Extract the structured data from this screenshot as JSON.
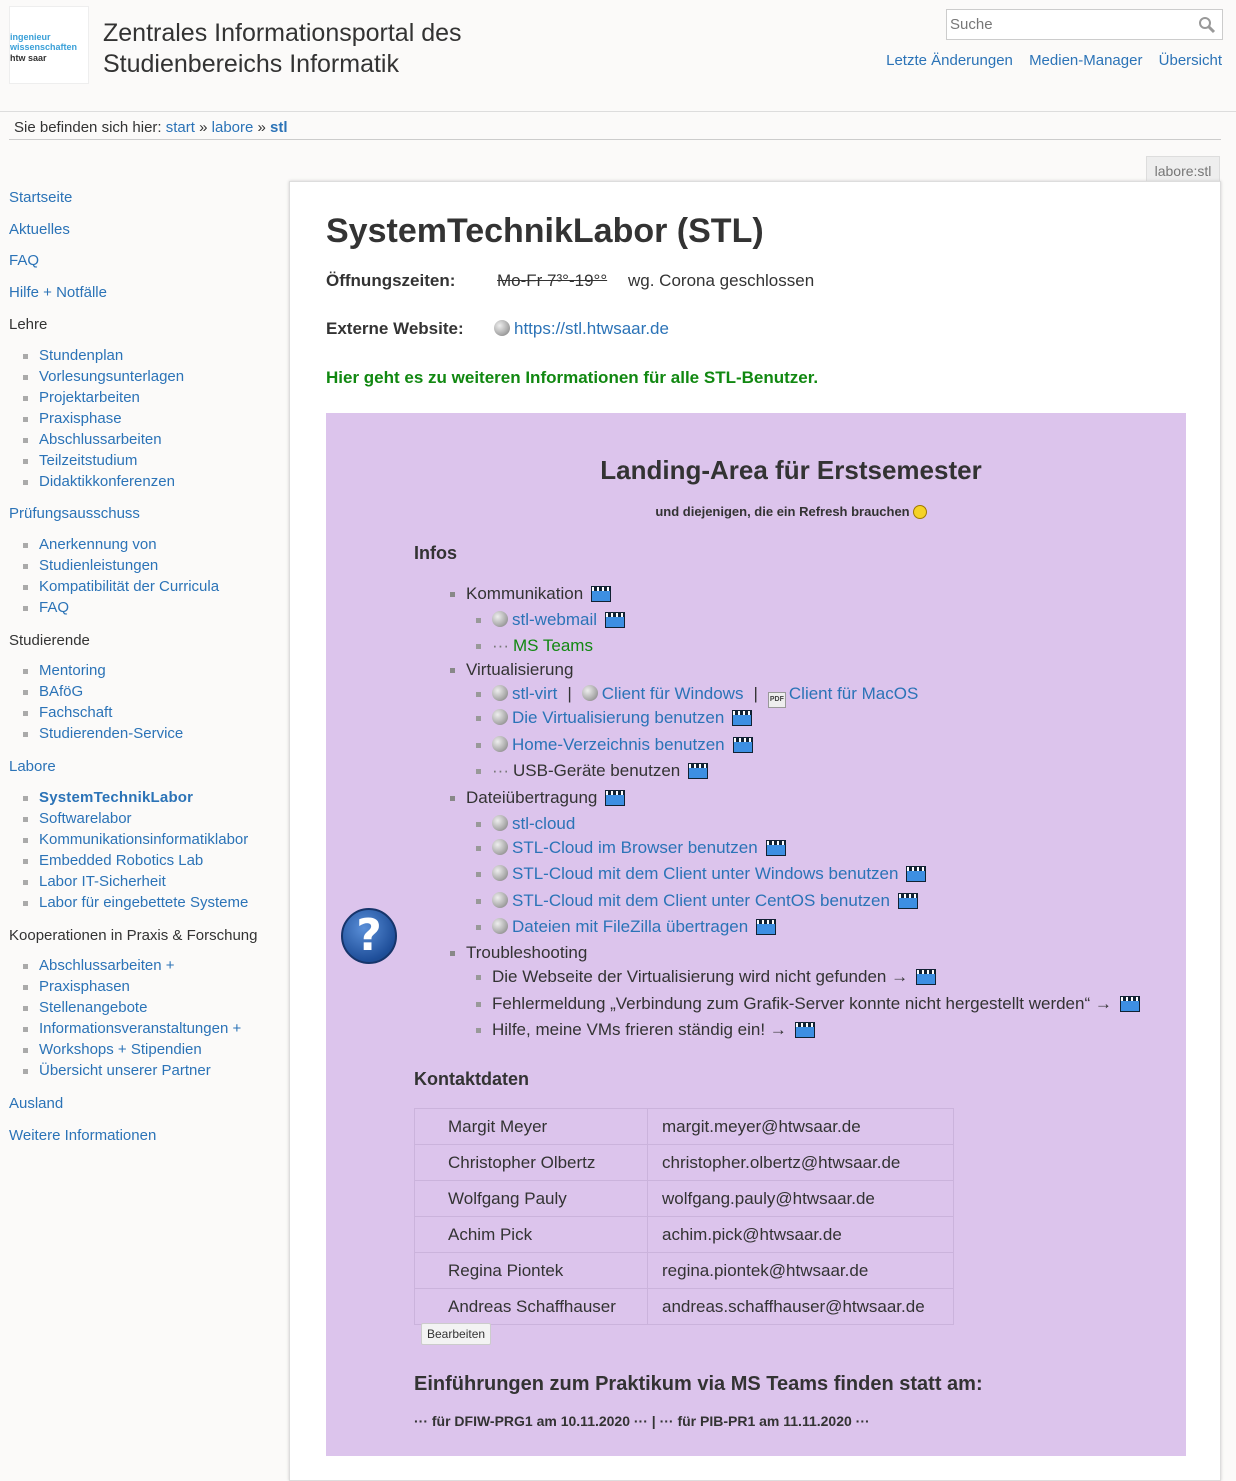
{
  "header": {
    "logo": {
      "line1": "ingenieur",
      "line2": "wissenschaften",
      "line3": "htw saar"
    },
    "title_line1": "Zentrales Informationsportal des",
    "title_line2": "Studienbereichs Informatik",
    "search_placeholder": "Suche",
    "usertools": [
      "Letzte Änderungen",
      "Medien-Manager",
      "Übersicht"
    ]
  },
  "breadcrumbs": {
    "prefix": "Sie befinden sich hier:",
    "items": [
      "start",
      "labore",
      "stl"
    ],
    "sep": "»"
  },
  "sidebar": {
    "startseite": "Startseite",
    "aktuelles": "Aktuelles",
    "faq": "FAQ",
    "hilfe": "Hilfe + Notfälle",
    "lehre": "Lehre",
    "lehre_items": [
      "Stundenplan",
      "Vorlesungsunterlagen",
      "Projektarbeiten",
      "Praxisphase",
      "Abschlussarbeiten",
      "Teilzeitstudium",
      "Didaktikkonferenzen"
    ],
    "pruefung": "Prüfungsausschuss",
    "pruefung_items": [
      "Anerkennung von",
      "Studienleistungen",
      "Kompatibilität der Curricula",
      "FAQ"
    ],
    "studierende": "Studierende",
    "studierende_items": [
      "Mentoring",
      "BAföG",
      "Fachschaft",
      "Studierenden-Service"
    ],
    "labore": "Labore",
    "labore_items": [
      "SystemTechnikLabor",
      "Softwarelabor",
      "Kommunikationsinformatiklabor",
      "Embedded Robotics Lab",
      "Labor IT-Sicherheit",
      "Labor für eingebettete Systeme"
    ],
    "kooperationen": "Kooperationen in Praxis & Forschung",
    "koop_items": [
      "Abschlussarbeiten +",
      "Praxisphasen",
      "Stellenangebote",
      "Informationsveranstaltungen +",
      "Workshops + Stipendien",
      "Übersicht unserer Partner"
    ],
    "ausland": "Ausland",
    "weitere": "Weitere Informationen"
  },
  "page": {
    "pageid": "labore:stl",
    "title": "SystemTechnikLabor (STL)",
    "hours_label": "Öffnungszeiten:",
    "hours_old": "Mo-Fr 7³°-19°°",
    "hours_note": "wg. Corona geschlossen",
    "website_label": "Externe Website:",
    "website_url": "https://stl.htwsaar.de",
    "info_link": "Hier geht es zu weiteren Informationen für alle STL-Benutzer."
  },
  "landing": {
    "title": "Landing-Area für Erstsemester",
    "subtitle": "und diejenigen, die ein Refresh brauchen",
    "infos_heading": "Infos",
    "kommunikation": "Kommunikation",
    "stl_webmail": "stl-webmail",
    "ms_teams": "MS Teams",
    "virtualisierung": "Virtualisierung",
    "stl_virt": "stl-virt",
    "client_windows": "Client für Windows",
    "client_macos": "Client für MacOS",
    "virt_benutzen": "Die Virtualisierung benutzen",
    "home_benutzen": "Home-Verzeichnis benutzen",
    "usb_benutzen": "USB-Geräte benutzen",
    "datei": "Dateiübertragung",
    "stl_cloud": "stl-cloud",
    "cloud_browser": "STL-Cloud im Browser benutzen",
    "cloud_windows": "STL-Cloud mit dem Client unter Windows benutzen",
    "cloud_centos": "STL-Cloud mit dem Client unter CentOS benutzen",
    "filezilla": "Dateien mit FileZilla übertragen",
    "troubleshooting": "Troubleshooting",
    "ts1": "Die Webseite der Virtualisierung wird nicht gefunden →",
    "ts2": "Fehlermeldung „Verbindung zum Grafik-Server konnte nicht hergestellt werden“ →",
    "ts3": "Hilfe, meine VMs frieren ständig ein! →",
    "kontakt_heading": "Kontaktdaten",
    "contacts": [
      {
        "name": "Margit Meyer",
        "email": "margit.meyer@htwsaar.de"
      },
      {
        "name": "Christopher Olbertz",
        "email": "christopher.olbertz@htwsaar.de"
      },
      {
        "name": "Wolfgang Pauly",
        "email": "wolfgang.pauly@htwsaar.de"
      },
      {
        "name": "Achim Pick",
        "email": "achim.pick@htwsaar.de"
      },
      {
        "name": "Regina Piontek",
        "email": "regina.piontek@htwsaar.de"
      },
      {
        "name": "Andreas Schaffhauser",
        "email": "andreas.schaffhauser@htwsaar.de"
      }
    ],
    "edit_button": "Bearbeiten",
    "einf_heading": "Einführungen zum Praktikum via MS Teams finden statt am:",
    "einf_text": "··· für DFIW-PRG1 am 10.11.2020 ··· | ··· für PIB-PR1 am 11.11.2020 ···"
  },
  "colors": {
    "link": "#2b73b7",
    "green": "#118811",
    "landing_bg": "#dcc4ec"
  }
}
